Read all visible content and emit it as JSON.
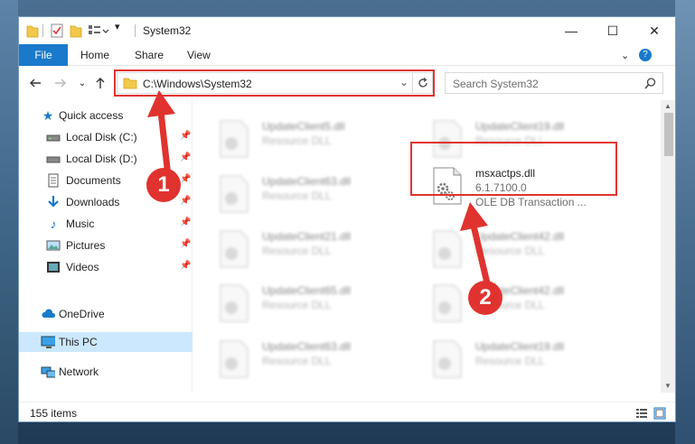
{
  "window": {
    "title": "System32",
    "controls": {
      "minimize": "—",
      "maximize": "☐",
      "close": "✕"
    }
  },
  "ribbon": {
    "tabs": [
      "File",
      "Home",
      "Share",
      "View"
    ],
    "help": "?"
  },
  "address_bar": {
    "path": "C:\\Windows\\System32"
  },
  "search": {
    "placeholder": "Search System32"
  },
  "nav_pane": {
    "items": [
      {
        "label": "Quick access",
        "icon": "star-icon"
      },
      {
        "label": "Local Disk (C:)",
        "icon": "drive-icon",
        "pinned": true
      },
      {
        "label": "Local Disk (D:)",
        "icon": "drive-icon",
        "pinned": true
      },
      {
        "label": "Documents",
        "icon": "documents-icon",
        "pinned": true
      },
      {
        "label": "Downloads",
        "icon": "download-icon",
        "pinned": true
      },
      {
        "label": "Music",
        "icon": "music-icon",
        "pinned": true
      },
      {
        "label": "Pictures",
        "icon": "pictures-icon",
        "pinned": true
      },
      {
        "label": "Videos",
        "icon": "videos-icon",
        "pinned": true
      },
      {
        "label": "OneDrive",
        "icon": "cloud-icon"
      },
      {
        "label": "This PC",
        "icon": "computer-icon",
        "selected": true
      },
      {
        "label": "Network",
        "icon": "network-icon"
      }
    ]
  },
  "files": {
    "left": [
      {
        "name": "UpdateClient5.dll",
        "type": "Resource DLL"
      },
      {
        "name": "UpdateClient63.dll",
        "type": "Resource DLL"
      },
      {
        "name": "UpdateClient21.dll",
        "type": "Resource DLL"
      },
      {
        "name": "UpdateClient65.dll",
        "type": "Resource DLL"
      },
      {
        "name": "UpdateClient63.dll",
        "type": "Resource DLL"
      }
    ],
    "right": [
      {
        "name": "UpdateClient19.dll",
        "type": "Resource DLL"
      },
      {
        "name": "msxactps.dll",
        "version": "6.1.7100.0",
        "type": "OLE DB Transaction ...",
        "highlighted": true
      },
      {
        "name": "UpdateClient42.dll",
        "type": "Resource DLL"
      },
      {
        "name": "UpdateClient42.dll",
        "type": "Resource DLL"
      },
      {
        "name": "UpdateClient19.dll",
        "type": "Resource DLL"
      }
    ]
  },
  "status_bar": {
    "item_count": "155 items"
  },
  "annotations": {
    "step1": "1",
    "step2": "2",
    "color": "#e0332f"
  }
}
